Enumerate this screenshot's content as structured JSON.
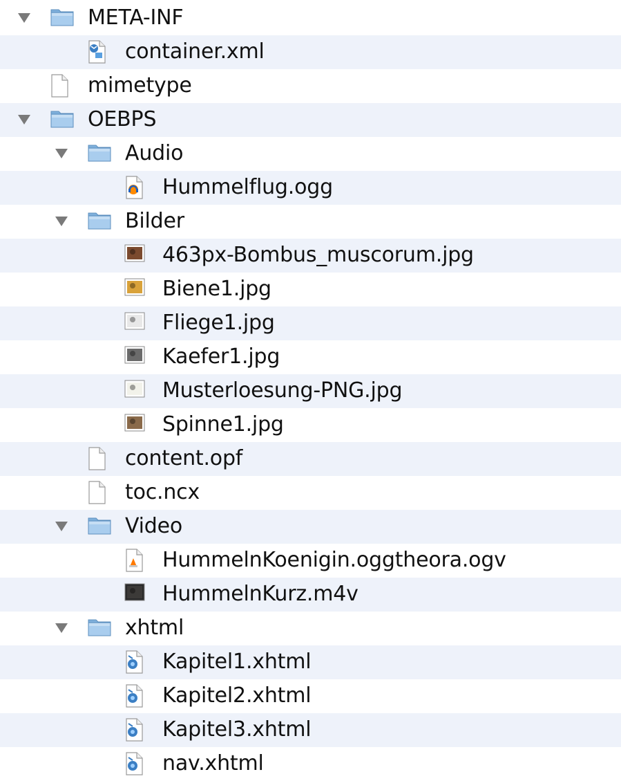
{
  "tree": [
    {
      "label": "META-INF",
      "depth": 0,
      "kind": "folder",
      "expanded": true,
      "icon": "folder-icon"
    },
    {
      "label": "container.xml",
      "depth": 1,
      "kind": "file",
      "icon": "xml-file-icon"
    },
    {
      "label": "mimetype",
      "depth": 1,
      "kind": "file",
      "icon": "document-icon",
      "shift": -1
    },
    {
      "label": "OEBPS",
      "depth": 0,
      "kind": "folder",
      "expanded": true,
      "icon": "folder-icon"
    },
    {
      "label": "Audio",
      "depth": 1,
      "kind": "folder",
      "expanded": true,
      "icon": "folder-icon"
    },
    {
      "label": "Hummelflug.ogg",
      "depth": 2,
      "kind": "file",
      "icon": "audio-file-icon"
    },
    {
      "label": "Bilder",
      "depth": 1,
      "kind": "folder",
      "expanded": true,
      "icon": "folder-icon"
    },
    {
      "label": "463px-Bombus_muscorum.jpg",
      "depth": 2,
      "kind": "file",
      "icon": "image-thumbnail-icon",
      "thumb": "#7b4a2e"
    },
    {
      "label": "Biene1.jpg",
      "depth": 2,
      "kind": "file",
      "icon": "image-thumbnail-icon",
      "thumb": "#d9a23a"
    },
    {
      "label": "Fliege1.jpg",
      "depth": 2,
      "kind": "file",
      "icon": "image-thumbnail-icon",
      "thumb": "#e8e8e8"
    },
    {
      "label": "Kaefer1.jpg",
      "depth": 2,
      "kind": "file",
      "icon": "image-thumbnail-icon",
      "thumb": "#6b6b6b"
    },
    {
      "label": "Musterloesung-PNG.jpg",
      "depth": 2,
      "kind": "file",
      "icon": "image-thumbnail-icon",
      "thumb": "#f2f2ea"
    },
    {
      "label": "Spinne1.jpg",
      "depth": 2,
      "kind": "file",
      "icon": "image-thumbnail-icon",
      "thumb": "#8a6a4a"
    },
    {
      "label": "content.opf",
      "depth": 2,
      "kind": "file",
      "icon": "document-icon",
      "shift": -1
    },
    {
      "label": "toc.ncx",
      "depth": 2,
      "kind": "file",
      "icon": "document-icon",
      "shift": -1
    },
    {
      "label": "Video",
      "depth": 1,
      "kind": "folder",
      "expanded": true,
      "icon": "folder-icon"
    },
    {
      "label": "HummelnKoenigin.oggtheora.ogv",
      "depth": 2,
      "kind": "file",
      "icon": "video-file-icon"
    },
    {
      "label": "HummelnKurz.m4v",
      "depth": 2,
      "kind": "file",
      "icon": "video-thumbnail-icon",
      "thumb": "#3c3a38"
    },
    {
      "label": "xhtml",
      "depth": 1,
      "kind": "folder",
      "expanded": true,
      "icon": "folder-icon"
    },
    {
      "label": "Kapitel1.xhtml",
      "depth": 2,
      "kind": "file",
      "icon": "xhtml-file-icon"
    },
    {
      "label": "Kapitel2.xhtml",
      "depth": 2,
      "kind": "file",
      "icon": "xhtml-file-icon"
    },
    {
      "label": "Kapitel3.xhtml",
      "depth": 2,
      "kind": "file",
      "icon": "xhtml-file-icon"
    },
    {
      "label": "nav.xhtml",
      "depth": 2,
      "kind": "file",
      "icon": "xhtml-file-icon"
    }
  ],
  "colors": {
    "row_alt": "#eef2fa",
    "folder": "#9cc3e6",
    "disclosure": "#7a7a7a"
  }
}
